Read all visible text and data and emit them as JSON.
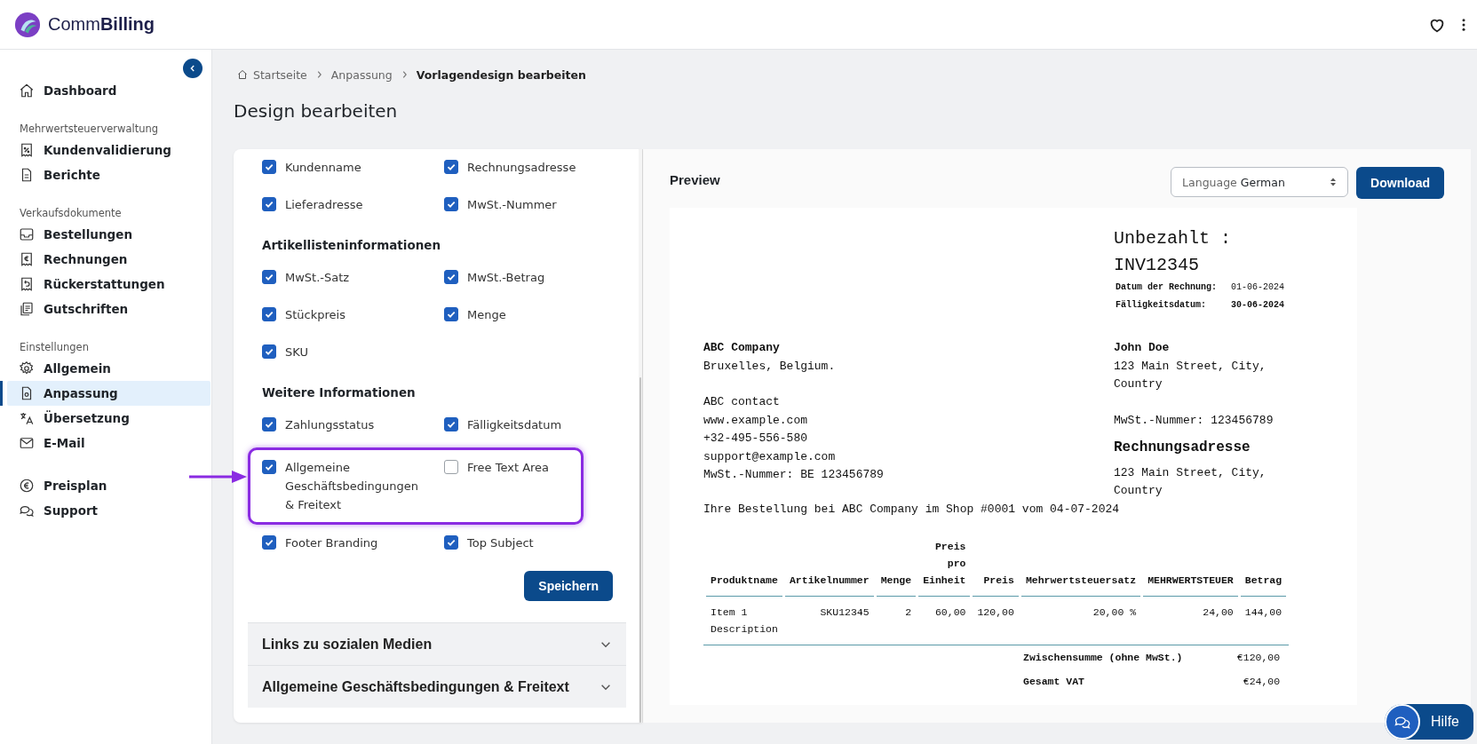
{
  "header": {
    "brand": "Comm**Billing**"
  },
  "sidebar": {
    "groups": [
      {
        "items": [
          {
            "label": "Dashboard",
            "selected": false
          }
        ]
      },
      {
        "heading": "Mehrwertsteuerverwaltung",
        "items": [
          {
            "label": "Kundenvalidierung",
            "selected": false
          },
          {
            "label": "Berichte",
            "selected": false
          }
        ]
      },
      {
        "heading": "Verkaufsdokumente",
        "items": [
          {
            "label": "Bestellungen",
            "selected": false
          },
          {
            "label": "Rechnungen",
            "selected": false
          },
          {
            "label": "Rückerstattungen",
            "selected": false
          },
          {
            "label": "Gutschriften",
            "selected": false
          }
        ]
      },
      {
        "heading": "Einstellungen",
        "items": [
          {
            "label": "Allgemein",
            "selected": false
          },
          {
            "label": "Anpassung",
            "selected": true
          },
          {
            "label": "Übersetzung",
            "selected": false
          },
          {
            "label": "E-Mail",
            "selected": false
          }
        ]
      },
      {
        "items": [
          {
            "label": "Preisplan",
            "selected": false
          },
          {
            "label": "Support",
            "selected": false
          }
        ]
      }
    ]
  },
  "breadcrumb": [
    "Startseite",
    "Anpassung",
    "Vorlagendesign bearbeiten"
  ],
  "page_title": "Design bearbeiten",
  "settings": {
    "sections": [
      {
        "rows": [
          {
            "highlighted": false,
            "options": [
              {
                "label": "Kundenname",
                "checked": true
              },
              {
                "label": "Rechnungsadresse",
                "checked": true
              }
            ]
          },
          {
            "highlighted": false,
            "options": [
              {
                "label": "Lieferadresse",
                "checked": true
              },
              {
                "label": "MwSt.-Nummer",
                "checked": true
              }
            ]
          }
        ]
      },
      {
        "heading": "Artikellisteninformationen",
        "rows": [
          {
            "highlighted": false,
            "options": [
              {
                "label": "MwSt.-Satz",
                "checked": true
              },
              {
                "label": "MwSt.-Betrag",
                "checked": true
              }
            ]
          },
          {
            "highlighted": false,
            "options": [
              {
                "label": "Stückpreis",
                "checked": true
              },
              {
                "label": "Menge",
                "checked": true
              }
            ]
          },
          {
            "highlighted": false,
            "options": [
              {
                "label": "SKU",
                "checked": true
              }
            ]
          }
        ]
      },
      {
        "heading": "Weitere Informationen",
        "rows": [
          {
            "highlighted": false,
            "options": [
              {
                "label": "Zahlungsstatus",
                "checked": true
              },
              {
                "label": "Fälligkeitsdatum",
                "checked": true
              }
            ]
          },
          {
            "highlighted": true,
            "options": [
              {
                "label": "Allgemeine Geschäftsbedingungen & Freitext",
                "checked": true
              },
              {
                "label": "Free Text Area",
                "checked": false
              }
            ]
          },
          {
            "highlighted": false,
            "options": [
              {
                "label": "Footer Branding",
                "checked": true
              },
              {
                "label": "Top Subject",
                "checked": true
              }
            ]
          }
        ]
      }
    ],
    "save_button": "Speichern",
    "accordions": [
      {
        "title": "Links zu sozialen Medien",
        "expanded": false
      },
      {
        "title": "Allgemeine Geschäftsbedingungen & Freitext",
        "expanded": false
      }
    ]
  },
  "preview": {
    "title": "Preview",
    "language": {
      "label": "Language",
      "value": "German"
    },
    "download_button": "Download",
    "invoice": {
      "status": "Unbezahlt :",
      "number": "INV12345",
      "meta": [
        {
          "label": "Datum der Rechnung:",
          "value": "01-06-2024",
          "bold": false
        },
        {
          "label": "Fälligkeitsdatum:",
          "value": "30-06-2024",
          "bold": true
        }
      ],
      "seller": {
        "name": "ABC Company",
        "address": "Bruxelles, Belgium.",
        "lines": [
          "ABC contact",
          "www.example.com",
          "+32-495-556-580",
          "support@example.com",
          "MwSt.-Nummer: BE 123456789"
        ]
      },
      "buyer": {
        "name": "John Doe",
        "address": "123 Main Street, City, Country",
        "vat": "MwSt.-Nummer: 123456789",
        "billing_heading": "Rechnungsadresse",
        "billing_address": "123 Main Street, City, Country"
      },
      "order_line": "Ihre Bestellung bei ABC Company im Shop #0001 vom 04-07-2024",
      "table": {
        "columns": [
          "Produktname",
          "Artikelnummer",
          "Menge",
          "Preis pro Einheit",
          "Preis",
          "Mehrwertsteuersatz",
          "MEHRWERTSTEUER",
          "Betrag"
        ],
        "rows": [
          [
            "Item 1 Description",
            "SKU12345",
            "2",
            "60,00",
            "120,00",
            "20,00 %",
            "24,00",
            "144,00"
          ]
        ]
      },
      "totals": [
        {
          "label": "Zwischensumme (ohne MwSt.)",
          "value": "€120,00"
        },
        {
          "label": "Gesamt VAT",
          "value": "€24,00"
        }
      ]
    }
  },
  "help_button": "Hilfe"
}
